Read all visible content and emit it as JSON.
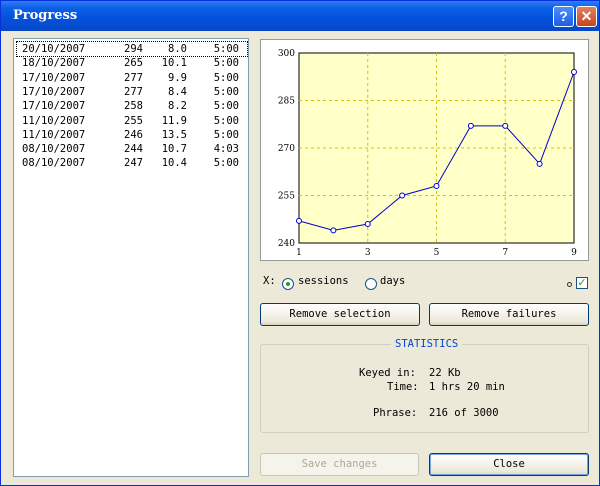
{
  "window": {
    "title": "Progress",
    "help_glyph": "?",
    "close_glyph": "✕"
  },
  "sessions": [
    {
      "date": "20/10/2007",
      "size": "294",
      "speed": "8.0",
      "time": "5:00"
    },
    {
      "date": "18/10/2007",
      "size": "265",
      "speed": "10.1",
      "time": "5:00"
    },
    {
      "date": "17/10/2007",
      "size": "277",
      "speed": "9.9",
      "time": "5:00"
    },
    {
      "date": "17/10/2007",
      "size": "277",
      "speed": "8.4",
      "time": "5:00"
    },
    {
      "date": "17/10/2007",
      "size": "258",
      "speed": "8.2",
      "time": "5:00"
    },
    {
      "date": "11/10/2007",
      "size": "255",
      "speed": "11.9",
      "time": "5:00"
    },
    {
      "date": "11/10/2007",
      "size": "246",
      "speed": "13.5",
      "time": "5:00"
    },
    {
      "date": "08/10/2007",
      "size": "244",
      "speed": "10.7",
      "time": "4:03"
    },
    {
      "date": "08/10/2007",
      "size": "247",
      "speed": "10.4",
      "time": "5:00"
    }
  ],
  "chart_data": {
    "type": "line",
    "x": [
      1,
      2,
      3,
      4,
      5,
      6,
      7,
      8,
      9
    ],
    "series": [
      {
        "values": [
          247,
          244,
          246,
          255,
          258,
          277,
          277,
          265,
          294
        ]
      }
    ],
    "xticks": [
      "1",
      "3",
      "5",
      "7",
      "9"
    ],
    "yticks": [
      "240",
      "255",
      "270",
      "285",
      "300"
    ],
    "xlim": [
      1,
      9
    ],
    "ylim": [
      240,
      300
    ],
    "grid": true,
    "background": "#ffffc8",
    "line_color": "#0000cc",
    "grid_color": "#e0c000"
  },
  "controls": {
    "x_label": "X:",
    "x_options": [
      {
        "label": "sessions",
        "selected": true
      },
      {
        "label": "days",
        "selected": false
      }
    ],
    "checkbox_checked": true,
    "remove_selection": "Remove selection",
    "remove_failures": "Remove failures",
    "save_changes": "Save changes",
    "close": "Close"
  },
  "statistics": {
    "title": "STATISTICS",
    "keyed_in_label": "Keyed in:",
    "keyed_in_value": "22 Kb",
    "time_label": "Time:",
    "time_value": "1 hrs 20 min",
    "phrase_label": "Phrase:",
    "phrase_value": "216 of 3000"
  }
}
